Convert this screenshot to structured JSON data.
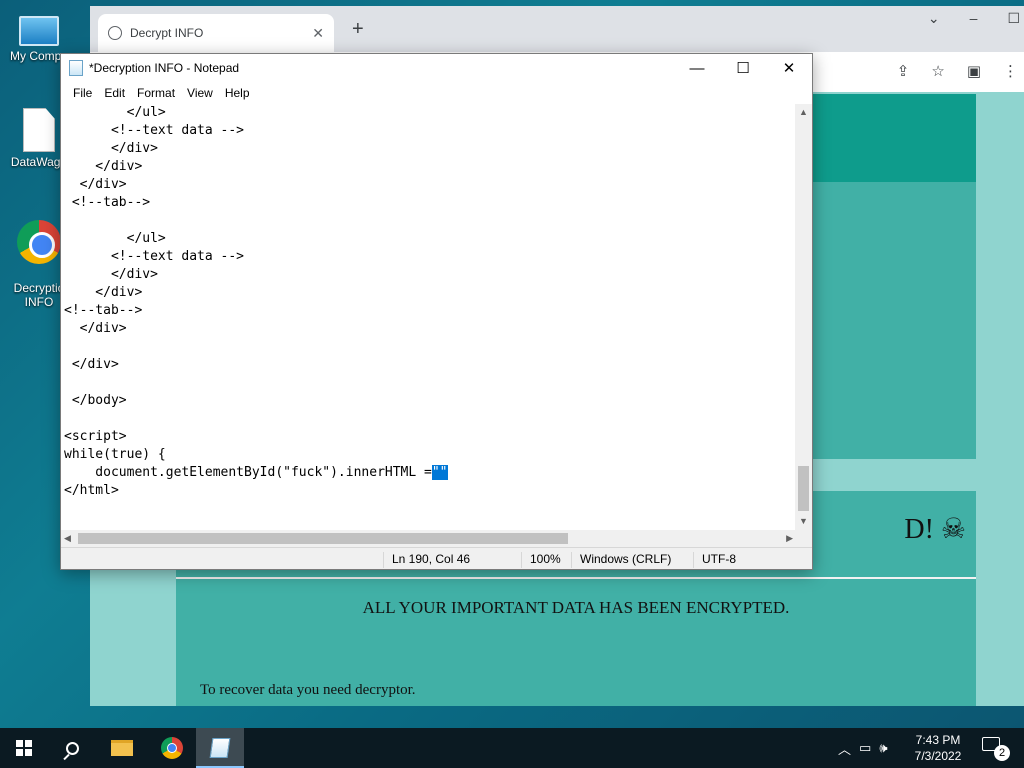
{
  "desktop": {
    "icons": [
      {
        "label": "My Compu"
      },
      {
        "label": "DataWago"
      },
      {
        "label": "Decryptio\nINFO"
      }
    ]
  },
  "browser": {
    "tab_title": "Decrypt INFO",
    "tab_close": "✕",
    "new_tab": "+",
    "page": {
      "heading": "D! ☠",
      "subheading": "ALL YOUR IMPORTANT DATA HAS BEEN ENCRYPTED.",
      "body_text": "To recover data you need decryptor."
    }
  },
  "notepad": {
    "title": "*Decryption INFO - Notepad",
    "menu": [
      "File",
      "Edit",
      "Format",
      "View",
      "Help"
    ],
    "code_lines": [
      "        </ul>",
      "      <!--text data -->",
      "      </div>",
      "    </div>",
      "  </div>",
      " <!--tab-->",
      "",
      "        </ul>",
      "      <!--text data -->",
      "      </div>",
      "    </div>",
      "<!--tab-->",
      "  </div>",
      "",
      " </div>",
      "",
      " </body>",
      "",
      "<script>",
      "while(true) {",
      "    document.getElementById(\"fuck\").innerHTML ="
    ],
    "selected_text": "\"\"",
    "last_line": "</html>",
    "status": {
      "position": "Ln 190, Col 46",
      "zoom": "100%",
      "line_ending": "Windows (CRLF)",
      "encoding": "UTF-8"
    }
  },
  "taskbar": {
    "clock_time": "7:43 PM",
    "clock_date": "7/3/2022",
    "notification_count": "2"
  }
}
